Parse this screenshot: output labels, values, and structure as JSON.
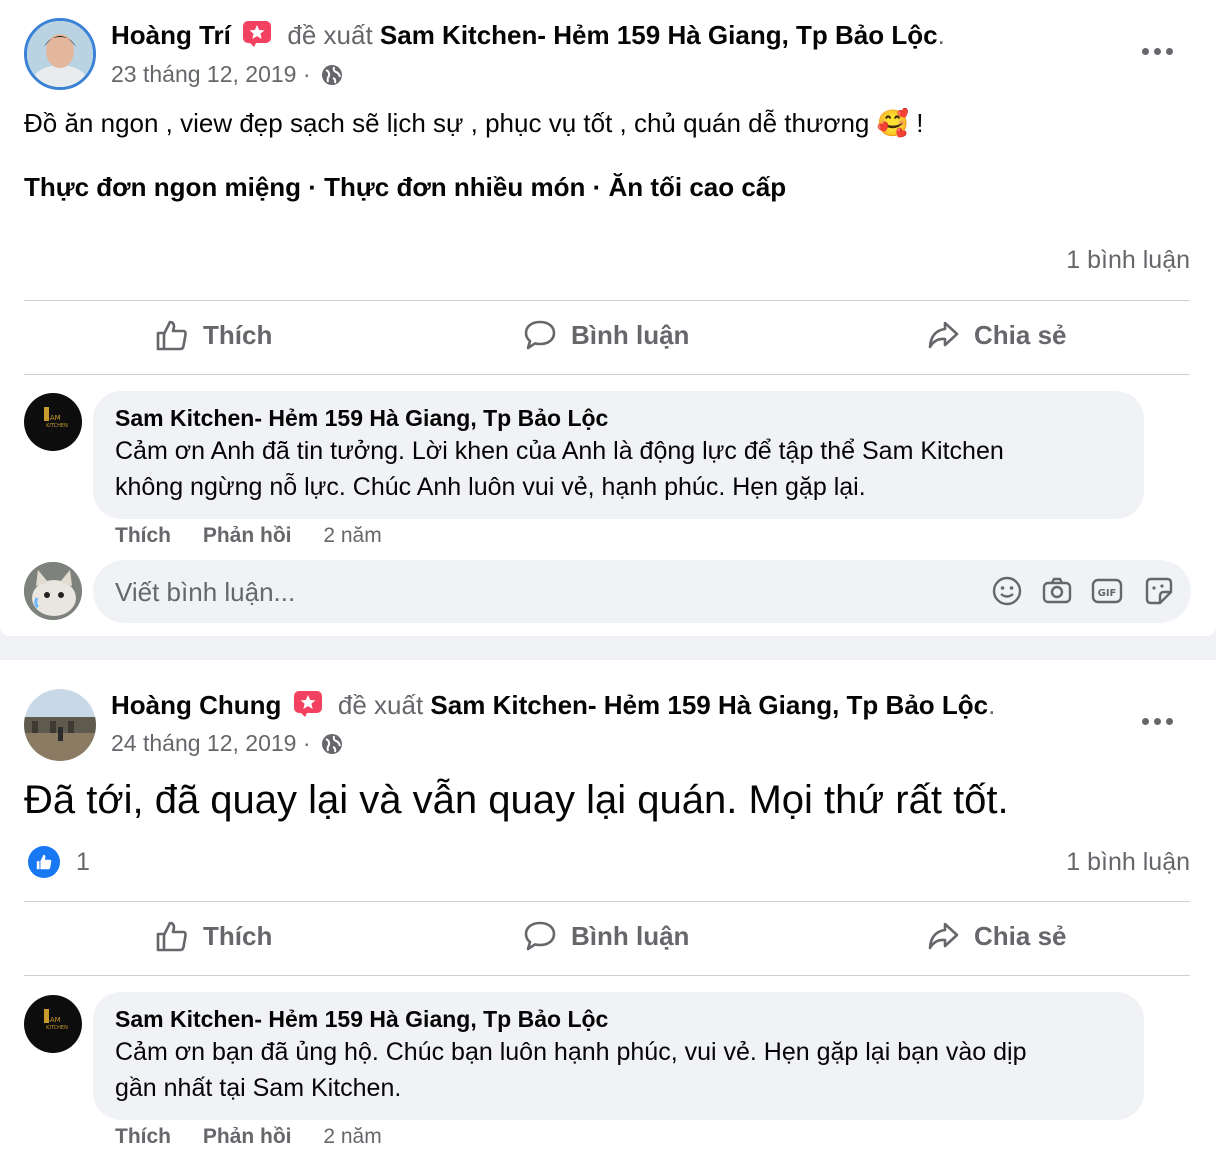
{
  "posts": [
    {
      "author": "Hoàng Trí",
      "verb": "đề xuất",
      "page": "Sam Kitchen- Hẻm 159 Hà Giang, Tp Bảo Lộc",
      "date": "23 tháng 12, 2019 ·",
      "text": "Đồ ăn ngon , view đẹp sạch sẽ lịch sự , phục vụ tốt , chủ quán dễ thương",
      "emoji": "🥰",
      "text_end": "!",
      "tags": "Thực đơn ngon miệng · Thực đơn nhiều món · Ăn tối cao cấp",
      "comment_count": "1 bình luận",
      "actions": {
        "like": "Thích",
        "comment": "Bình luận",
        "share": "Chia sẻ"
      },
      "reply": {
        "name": "Sam Kitchen- Hẻm 159 Hà Giang, Tp Bảo Lộc",
        "line1": "Cảm ơn Anh đã tin tưởng. Lời khen của Anh là động lực để tập thể Sam Kitchen",
        "line2": "không ngừng nỗ lực. Chúc Anh luôn vui vẻ, hạnh phúc. Hẹn gặp lại.",
        "like": "Thích",
        "reply": "Phản hồi",
        "time": "2 năm"
      },
      "write_placeholder": "Viết bình luận...",
      "logo_text": "SAM KITCHEN"
    },
    {
      "author": "Hoàng Chung",
      "verb": "đề xuất",
      "page": "Sam Kitchen- Hẻm 159 Hà Giang, Tp Bảo Lộc",
      "date": "24 tháng 12, 2019 ·",
      "text": "Đã tới, đã quay lại và vẫn quay lại quán. Mọi thứ rất tốt.",
      "likes": "1",
      "comment_count": "1 bình luận",
      "actions": {
        "like": "Thích",
        "comment": "Bình luận",
        "share": "Chia sẻ"
      },
      "reply": {
        "name": "Sam Kitchen- Hẻm 159 Hà Giang, Tp Bảo Lộc",
        "line1": "Cảm ơn bạn đã ủng hộ. Chúc bạn luôn hạnh phúc, vui vẻ. Hẹn gặp lại bạn vào dịp",
        "line2": "gần nhất tại Sam Kitchen.",
        "like": "Thích",
        "reply": "Phản hồi",
        "time": "2 năm"
      }
    }
  ],
  "icons": [
    "recommend-badge-icon",
    "globe-icon",
    "more-icon",
    "like-icon",
    "comment-icon",
    "share-icon",
    "emoji-icon",
    "camera-icon",
    "gif-icon",
    "sticker-icon"
  ],
  "colors": {
    "link": "#1877f2",
    "muted": "#65676b",
    "bubble": "#f0f2f5",
    "badge": "#f3425f"
  }
}
